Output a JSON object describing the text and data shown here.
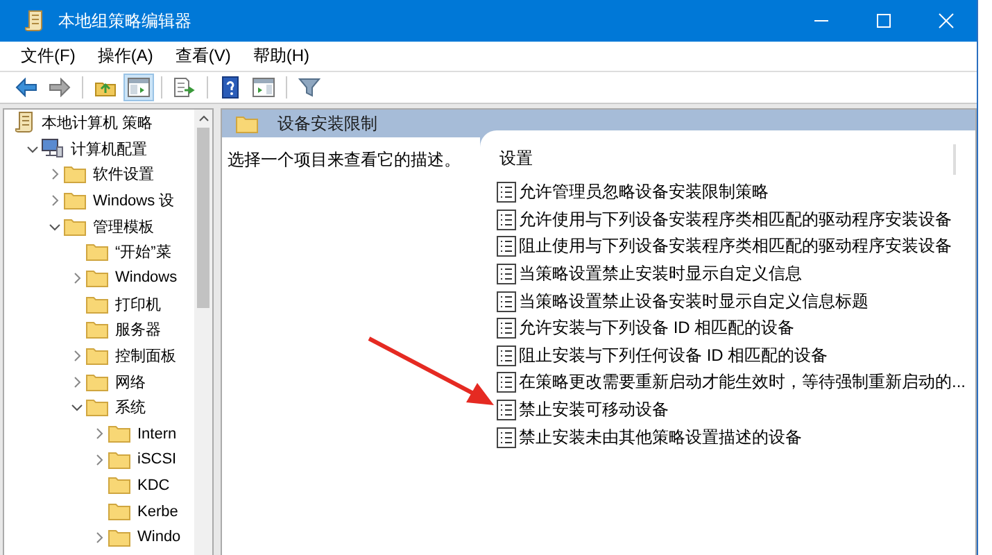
{
  "window": {
    "title": "本地组策略编辑器"
  },
  "menu": [
    "文件(F)",
    "操作(A)",
    "查看(V)",
    "帮助(H)"
  ],
  "toolbar": [
    {
      "kind": "back"
    },
    {
      "kind": "forward"
    },
    {
      "kind": "separator"
    },
    {
      "kind": "up"
    },
    {
      "kind": "tree",
      "pressed": true
    },
    {
      "kind": "separator"
    },
    {
      "kind": "export"
    },
    {
      "kind": "separator"
    },
    {
      "kind": "help"
    },
    {
      "kind": "panel"
    },
    {
      "kind": "separator"
    },
    {
      "kind": "filter"
    }
  ],
  "tree": [
    {
      "label": "本地计算机 策略",
      "children": [
        {
          "label": "计算机配置",
          "expanded": true,
          "children": [
            {
              "label": "软件设置",
              "expanded": false
            },
            {
              "label": "Windows 设",
              "expanded": false
            },
            {
              "label": "管理模板",
              "expanded": true,
              "children": [
                {
                  "label": "“开始”菜"
                },
                {
                  "label": "Windows",
                  "expanded": false
                },
                {
                  "label": "打印机"
                },
                {
                  "label": "服务器"
                },
                {
                  "label": "控制面板",
                  "expanded": false
                },
                {
                  "label": "网络",
                  "expanded": false
                },
                {
                  "label": "系统",
                  "expanded": true,
                  "children": [
                    {
                      "label": "Intern",
                      "expanded": false
                    },
                    {
                      "label": "iSCSI",
                      "expanded": false
                    },
                    {
                      "label": "KDC"
                    },
                    {
                      "label": "Kerbe"
                    },
                    {
                      "label": "Windo",
                      "expanded": false
                    }
                  ]
                }
              ]
            }
          ]
        }
      ]
    }
  ],
  "panel": {
    "title": "设备安装限制",
    "description": "选择一个项目来查看它的描述。",
    "column": "设置",
    "settings": [
      "允许管理员忽略设备安装限制策略",
      "允许使用与下列设备安装程序类相匹配的驱动程序安装设备",
      "阻止使用与下列设备安装程序类相匹配的驱动程序安装设备",
      "当策略设置禁止安装时显示自定义信息",
      "当策略设置禁止设备安装时显示自定义信息标题",
      "允许安装与下列设备 ID 相匹配的设备",
      "阻止安装与下列任何设备 ID 相匹配的设备",
      "在策略更改需要重新启动才能生效时，等待强制重新启动的...",
      "禁止安装可移动设备",
      "禁止安装未由其他策略设置描述的设备"
    ]
  },
  "overlay": {
    "kind": "arrow"
  }
}
